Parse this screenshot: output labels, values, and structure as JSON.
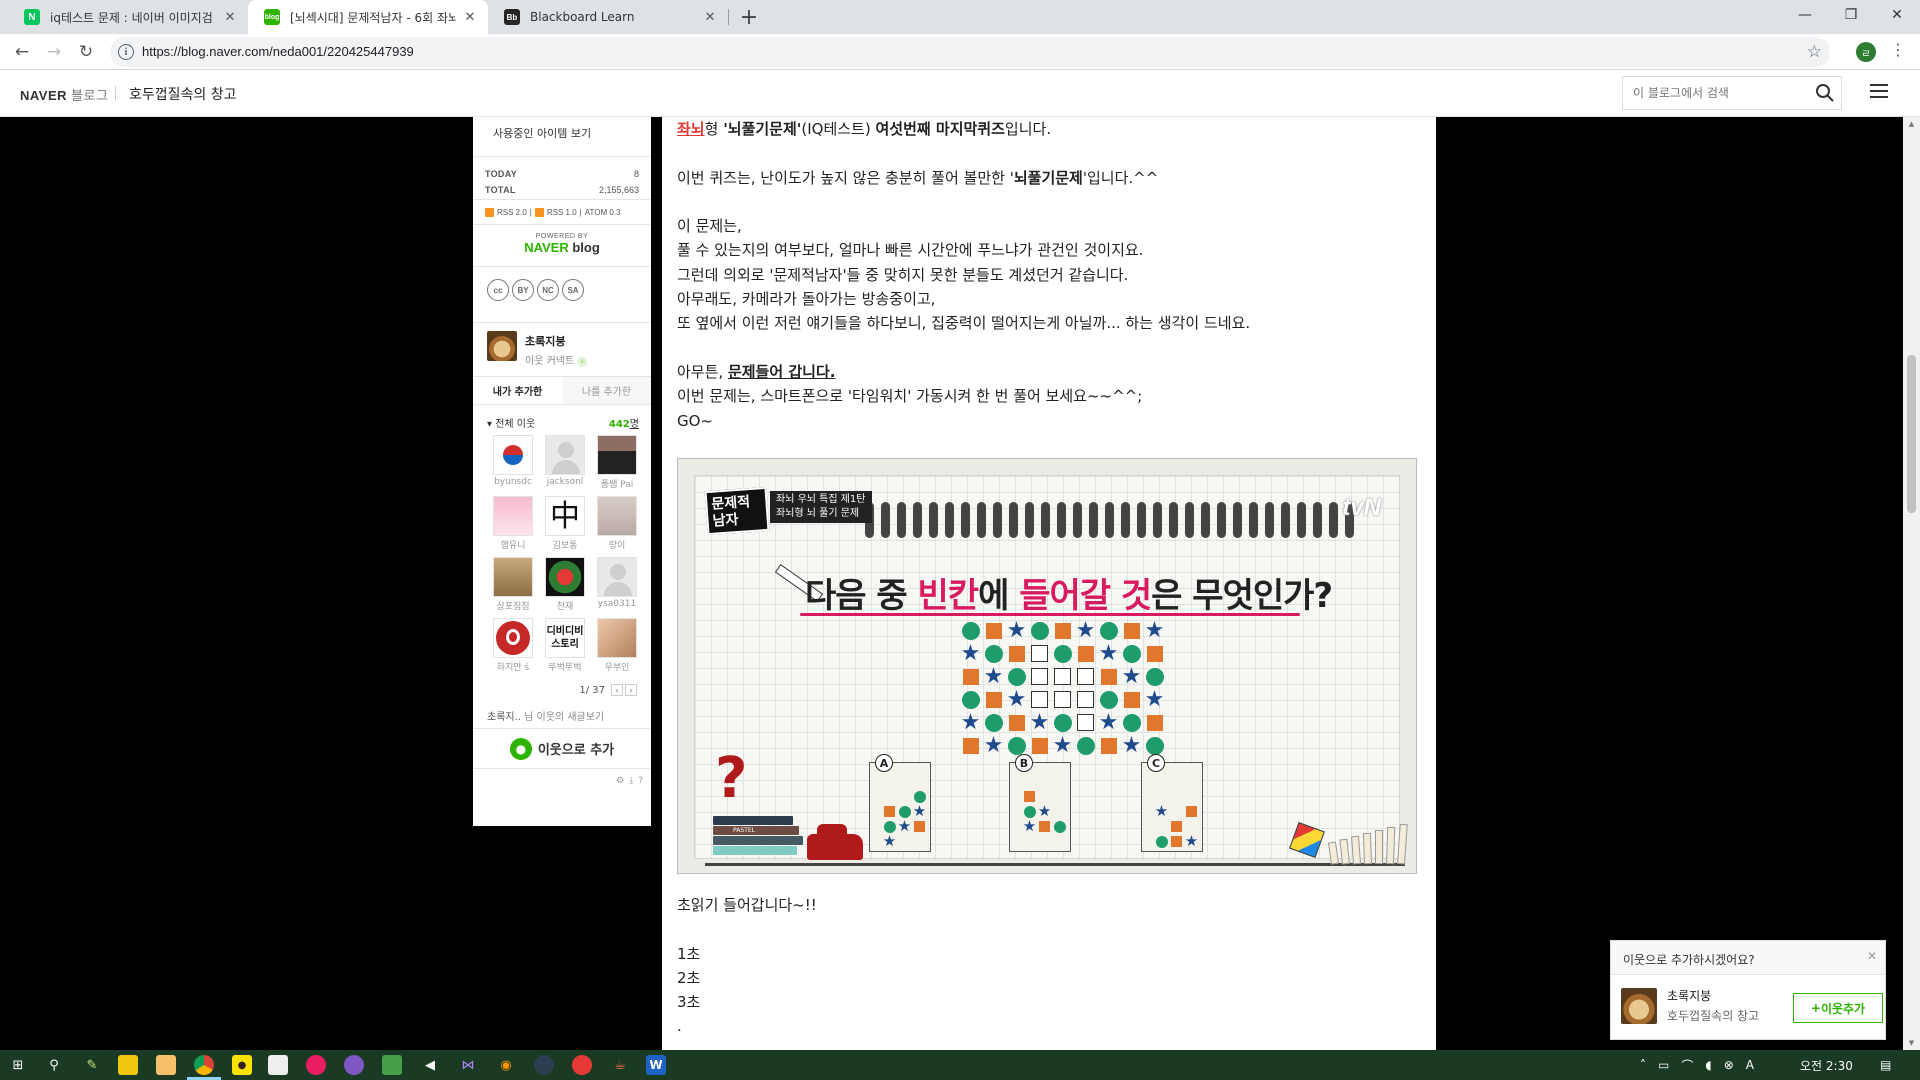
{
  "browser": {
    "tabs": [
      {
        "title": "iq테스트 문제 : 네이버 이미지검",
        "favicon": "N",
        "favicon_color": "#03c75a"
      },
      {
        "title": "[뇌섹시대] 문제적남자 - 6회 좌뇌",
        "favicon": "blog",
        "favicon_color": "#2db400"
      },
      {
        "title": "Blackboard Learn",
        "favicon": "Bb",
        "favicon_color": "#262626"
      }
    ],
    "url": "https://blog.naver.com/neda001/220425447939",
    "profile_initial": "ㄹ"
  },
  "blog_header": {
    "logo": "NAVER",
    "logo_sub": "블로그",
    "blog_title": "호두껍질속의 창고",
    "search_placeholder": "이 블로그에서 검색"
  },
  "sidebar": {
    "items_link": "사용중인 아이템 보기",
    "stats": [
      {
        "label": "TODAY",
        "value": "8"
      },
      {
        "label": "TOTAL",
        "value": "2,155,663"
      }
    ],
    "rss": [
      "RSS 2.0",
      "|",
      "RSS 1.0",
      "|",
      "ATOM 0.3"
    ],
    "powered_by": "POWERED BY",
    "powered_brand": "NAVER",
    "powered_brand_sub": "blog",
    "cc_badges": [
      "cc",
      "BY",
      "NC",
      "SA"
    ],
    "owner_name": "초록지붕",
    "owner_link": "이웃 커넥트",
    "tabs": [
      "내가 추가한",
      "나를 추가한"
    ],
    "neighbors_label": "전체 이웃",
    "neighbors_count": "442",
    "neighbors_unit": "명",
    "neighbors": [
      {
        "name": "byunsdc"
      },
      {
        "name": "jacksonl"
      },
      {
        "name": "퐁쌤 Pai"
      },
      {
        "name": "햄유니"
      },
      {
        "name": "김보통"
      },
      {
        "name": "량이"
      },
      {
        "name": "상포짐짐"
      },
      {
        "name": "천재"
      },
      {
        "name": "ysa0311"
      },
      {
        "name": "하지만 ś"
      },
      {
        "name": "뚜벅뚜벅"
      },
      {
        "name": "우부인"
      }
    ],
    "pager": "1/ 37",
    "new_posts_prefix": "초록지..",
    "new_posts_text": "님 이웃의 새글보기",
    "add_button": "이웃으로 추가"
  },
  "post": {
    "line1_red": "좌뇌",
    "line1_a": "형 ",
    "line1_b": "'뇌풀기문제'",
    "line1_c": "(IQ테스트) ",
    "line1_d": "여섯번째 마지막퀴즈",
    "line1_e": "입니다.",
    "line2_a": "이번 퀴즈는, 난이도가 높지 않은 충분히  풀어 볼만한 '",
    "line2_b": "뇌풀기문제",
    "line2_c": "'입니다.^^",
    "para1": [
      "이 문제는,",
      "풀 수 있는지의 여부보다, 얼마나 빠른 시간안에 푸느냐가 관건인 것이지요.",
      "그런데 의외로 '문제적남자'들 중 맞히지 못한 분들도 계셨던거 같습니다.",
      "아무래도, 카메라가 돌아가는 방송중이고,",
      "또 옆에서 이런 저런 얘기들을 하다보니, 집중력이 떨어지는게 아닐까... 하는 생각이 드네요."
    ],
    "para2_a": "아무튼, ",
    "para2_b": "문제들어 갑니다.",
    "para2_line2": "이번 문제는, 스마트폰으로 '타임워치' 가동시켜 한 번 풀어 보세요~~^^;",
    "para2_line3": "GO~",
    "after_image": "초읽기 들어갑니다~!!",
    "countdown": [
      "1초",
      "2초",
      "3초",
      "."
    ]
  },
  "quiz_image": {
    "badge": "문제적 남자",
    "badge_sub1": "좌뇌 우뇌 특집 제1탄",
    "badge_sub2": "좌뇌형 뇌 풀기 문제",
    "channel": "tvN",
    "title_a": "다음 중 ",
    "title_b": "빈칸",
    "title_c": "에 ",
    "title_d": "들어갈 것",
    "title_e": "은 무엇인가?",
    "grid": [
      [
        "C",
        "S",
        "T",
        "C",
        "S",
        "T",
        "C",
        "S",
        "T"
      ],
      [
        "T",
        "C",
        "S",
        "B",
        "C",
        "S",
        "T",
        "C",
        "S"
      ],
      [
        "S",
        "T",
        "C",
        "B",
        "B",
        "B",
        "S",
        "T",
        "C"
      ],
      [
        "C",
        "S",
        "T",
        "B",
        "B",
        "B",
        "C",
        "S",
        "T"
      ],
      [
        "T",
        "C",
        "S",
        "T",
        "C",
        "B",
        "T",
        "C",
        "S"
      ],
      [
        "S",
        "T",
        "C",
        "S",
        "T",
        "C",
        "S",
        "T",
        "C"
      ]
    ],
    "options": [
      {
        "label": "A",
        "grid": [
          [
            "",
            "",
            "C"
          ],
          [
            "S",
            "C",
            "T"
          ],
          [
            "C",
            "T",
            "S"
          ],
          [
            "T",
            "",
            ""
          ]
        ]
      },
      {
        "label": "B",
        "grid": [
          [
            "S",
            "",
            ""
          ],
          [
            "C",
            "T",
            ""
          ],
          [
            "T",
            "S",
            "C"
          ],
          [
            "",
            "",
            ""
          ]
        ]
      },
      {
        "label": "C",
        "grid": [
          [
            "",
            "",
            ""
          ],
          [
            "T",
            "",
            "S"
          ],
          [
            "",
            "S",
            ""
          ],
          [
            "C",
            "S",
            "T"
          ]
        ]
      }
    ],
    "books_label": "PASTEL"
  },
  "popup": {
    "title": "이웃으로 추가하시겠어요?",
    "name": "초록지붕",
    "blog": "호두껍질속의 창고",
    "button": "이웃추가"
  },
  "taskbar": {
    "time": "오전 2:30",
    "ime": "A"
  },
  "colors": {
    "naver_green": "#2db400",
    "quiz_circle": "#1e9d6a",
    "quiz_square": "#e0772c",
    "quiz_star": "#1f4a8c",
    "quiz_title_accent": "#d81b60"
  }
}
